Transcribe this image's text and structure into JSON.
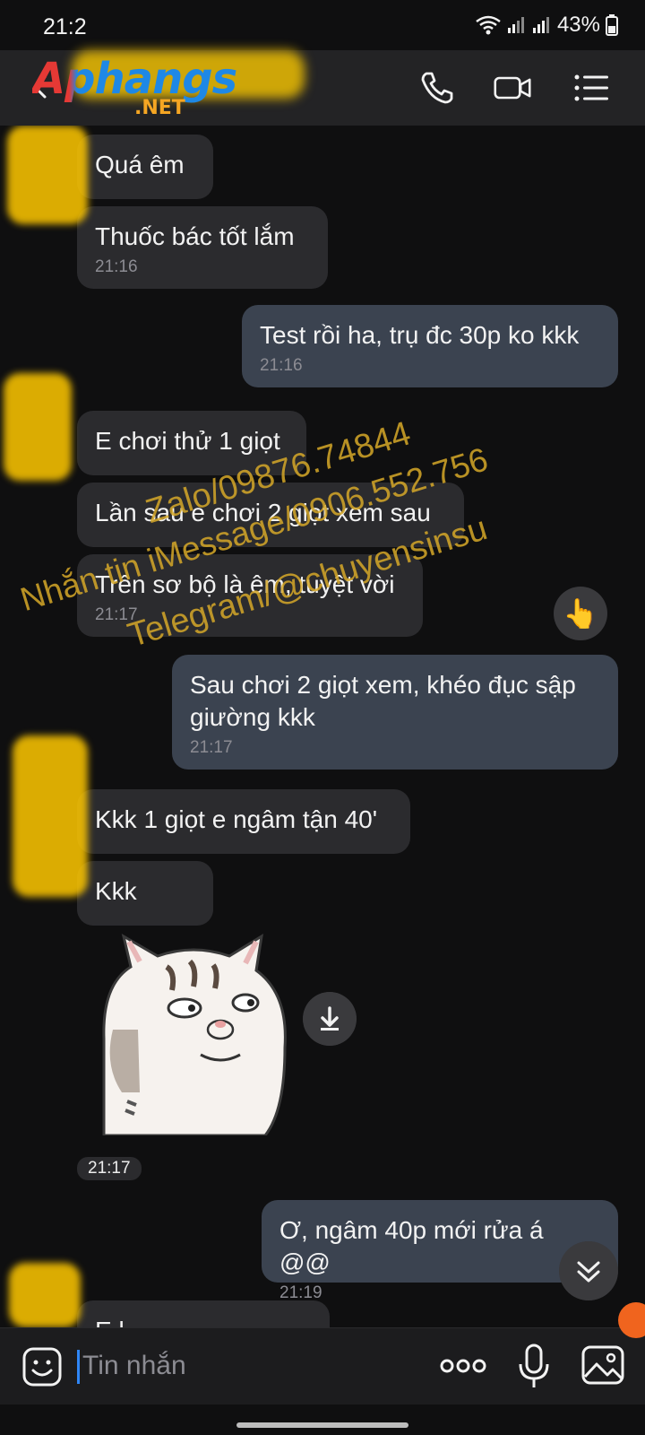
{
  "status_bar": {
    "time": "21:2",
    "battery": "43%"
  },
  "header": {
    "logo_main": "Aphangs",
    "logo_sub": ".NET"
  },
  "messages": [
    {
      "text": "Quá êm",
      "time": ""
    },
    {
      "text": "Thuốc bác tốt lắm",
      "time": "21:16"
    },
    {
      "text": "Test rồi ha, trụ đc 30p ko kkk",
      "time": "21:16"
    },
    {
      "text": "E chơi thử 1 giọt",
      "time": ""
    },
    {
      "text": "Lần sau e chơi 2 giọt xem sau",
      "time": ""
    },
    {
      "text": "Trên sơ bộ là êm, tuyệt vời",
      "time": "21:17"
    },
    {
      "text": "Sau chơi 2 giọt xem, khéo đục sập giường kkk",
      "time": "21:17"
    },
    {
      "text": "Kkk 1 giọt e ngâm tận 40'",
      "time": ""
    },
    {
      "text": "Kkk",
      "time": ""
    },
    {
      "text": "Ơ, ngâm 40p mới rửa á @@",
      "time": "21:19"
    },
    {
      "text": "E l",
      "time": ""
    }
  ],
  "sticker": {
    "time": "21:17"
  },
  "reaction": {
    "emoji": "👆"
  },
  "watermark": {
    "line1": "Zalo/09876.74844",
    "line2": "Nhắn tin iMessage/0906.552.756",
    "line3": "Telegram/@chuyensinsu"
  },
  "input": {
    "placeholder": "Tin nhắn"
  },
  "colors": {
    "incoming": "#2b2b2e",
    "outgoing": "#3b4350",
    "accent": "#2f86f6"
  }
}
